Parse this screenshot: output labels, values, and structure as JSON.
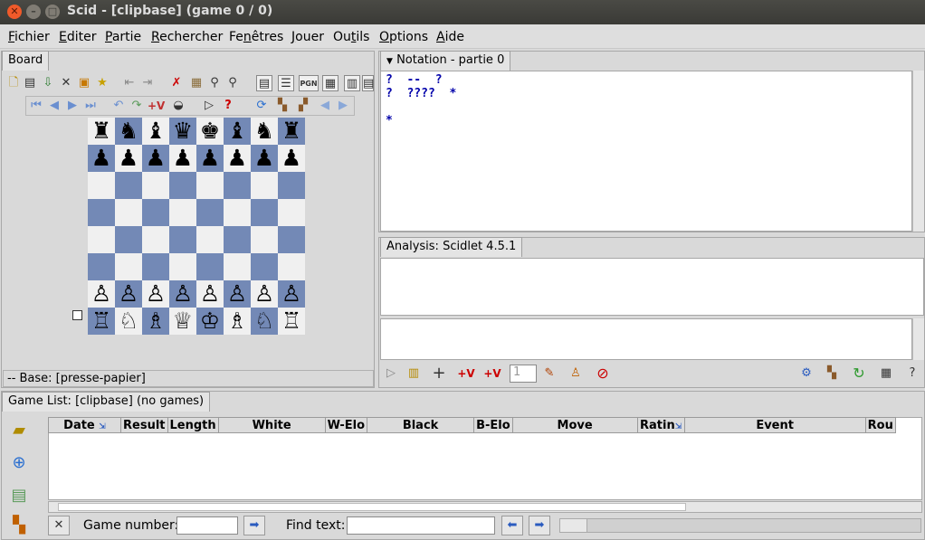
{
  "window": {
    "title": "Scid - [clipbase] (game 0 / 0)"
  },
  "menu": [
    {
      "label": "Fichier",
      "key": "F",
      "rest": "ichier"
    },
    {
      "label": "Editer",
      "key": "E",
      "rest": "diter"
    },
    {
      "label": "Partie",
      "key": "P",
      "rest": "artie"
    },
    {
      "label": "Rechercher",
      "key": "R",
      "rest": "echercher"
    },
    {
      "label": "Fenêtres",
      "key": "n",
      "pre": "Fe",
      "rest": "êtres"
    },
    {
      "label": "Jouer",
      "key": "J",
      "rest": "ouer"
    },
    {
      "label": "Outils",
      "key": "t",
      "pre": "Ou",
      "rest": "ils"
    },
    {
      "label": "Options",
      "key": "O",
      "rest": "ptions"
    },
    {
      "label": "Aide",
      "key": "A",
      "rest": "ide"
    }
  ],
  "board_panel": {
    "tab": "Board",
    "status": "--  Base: [presse-papier]",
    "rows": [
      [
        "♜",
        "♞",
        "♝",
        "♛",
        "♚",
        "♝",
        "♞",
        "♜"
      ],
      [
        "♟",
        "♟",
        "♟",
        "♟",
        "♟",
        "♟",
        "♟",
        "♟"
      ],
      [
        "",
        "",
        "",
        "",
        "",
        "",
        "",
        ""
      ],
      [
        "",
        "",
        "",
        "",
        "",
        "",
        "",
        ""
      ],
      [
        "",
        "",
        "",
        "",
        "",
        "",
        "",
        ""
      ],
      [
        "",
        "",
        "",
        "",
        "",
        "",
        "",
        ""
      ],
      [
        "♙",
        "♙",
        "♙",
        "♙",
        "♙",
        "♙",
        "♙",
        "♙"
      ],
      [
        "♖",
        "♘",
        "♗",
        "♕",
        "♔",
        "♗",
        "♘",
        "♖"
      ]
    ]
  },
  "notation": {
    "tab": "Notation - partie 0",
    "line1": "?  --  ?",
    "line2": "?  ????  *",
    "line3": "*"
  },
  "analysis": {
    "tab": "Analysis: Scidlet 4.5.1",
    "depth_value": "1"
  },
  "gamelist": {
    "tab": "Game List: [clipbase] (no games)",
    "columns": [
      "Date",
      "Result",
      "Length",
      "White",
      "W-Elo",
      "Black",
      "B-Elo",
      "Move",
      "Ratin",
      "Event",
      "Rou"
    ],
    "game_number_label": "Game number:",
    "find_text_label": "Find text:",
    "game_number_value": "",
    "find_text_value": ""
  },
  "colors": {
    "board_dark": "#7389b6",
    "board_light": "#f0f0f0",
    "notation_text": "#0000aa"
  }
}
